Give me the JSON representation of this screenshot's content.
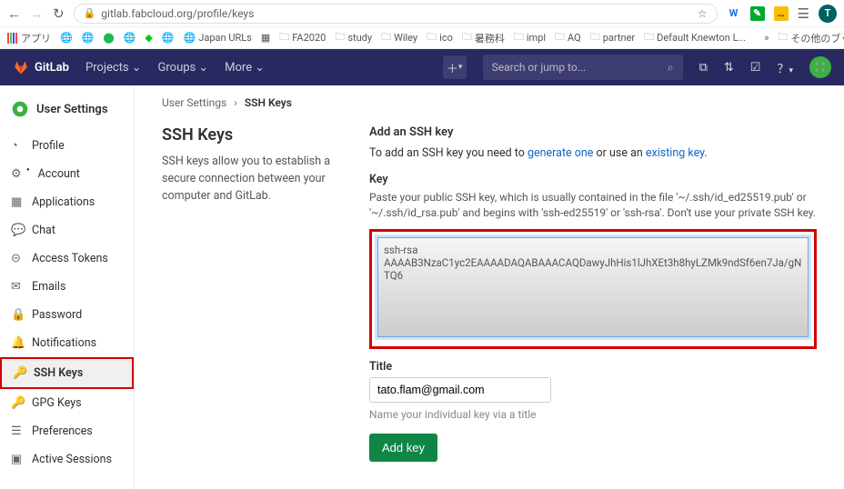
{
  "browser": {
    "url": "gitlab.fabcloud.org/profile/keys",
    "avatar_letter": "T"
  },
  "bookmarks": {
    "apps": "アプリ",
    "items": [
      "Japan URLs",
      "FA2020",
      "study",
      "Wiley",
      "ico",
      "暑務科",
      "impl",
      "AQ",
      "partner",
      "Default Knewton L..."
    ],
    "overflow": "その他のブックマー…"
  },
  "topbar": {
    "brand": "GitLab",
    "links": [
      "Projects",
      "Groups",
      "More"
    ],
    "search_placeholder": "Search or jump to..."
  },
  "sidebar": {
    "title": "User Settings",
    "items": [
      {
        "icon": "◔",
        "label": "Profile"
      },
      {
        "icon": "⚙",
        "label": "Account",
        "badge": true
      },
      {
        "icon": "▦",
        "label": "Applications"
      },
      {
        "icon": "💬",
        "label": "Chat"
      },
      {
        "icon": "⊝",
        "label": "Access Tokens"
      },
      {
        "icon": "✉",
        "label": "Emails"
      },
      {
        "icon": "🔒",
        "label": "Password"
      },
      {
        "icon": "🔔",
        "label": "Notifications"
      },
      {
        "icon": "🔑",
        "label": "SSH Keys",
        "active": true,
        "hl": true
      },
      {
        "icon": "🔑",
        "label": "GPG Keys"
      },
      {
        "icon": "☰",
        "label": "Preferences"
      },
      {
        "icon": "▣",
        "label": "Active Sessions"
      }
    ]
  },
  "crumb": {
    "a": "User Settings",
    "b": "SSH Keys"
  },
  "left": {
    "heading": "SSH Keys",
    "desc": "SSH keys allow you to establish a secure connection between your computer and GitLab."
  },
  "form": {
    "section_title": "Add an SSH key",
    "help_pre": "To add an SSH key you need to ",
    "help_link1": "generate one",
    "help_mid": " or use an ",
    "help_link2": "existing key",
    "key_label": "Key",
    "key_desc": "Paste your public SSH key, which is usually contained in the file '~/.ssh/id_ed25519.pub' or '~/.ssh/id_rsa.pub' and begins with 'ssh-ed25519' or 'ssh-rsa'. Don't use your private SSH key.",
    "key_value": "ssh-rsa\nAAAAB3NzaC1yc2EAAAADAQABAAACAQDawyJhHis1lJhXEt3h8hyLZMk9ndSf6en7Ja/gNTQ6",
    "title_label": "Title",
    "title_value": "tato.flam@gmail.com",
    "title_hint": "Name your individual key via a title",
    "submit": "Add key"
  }
}
